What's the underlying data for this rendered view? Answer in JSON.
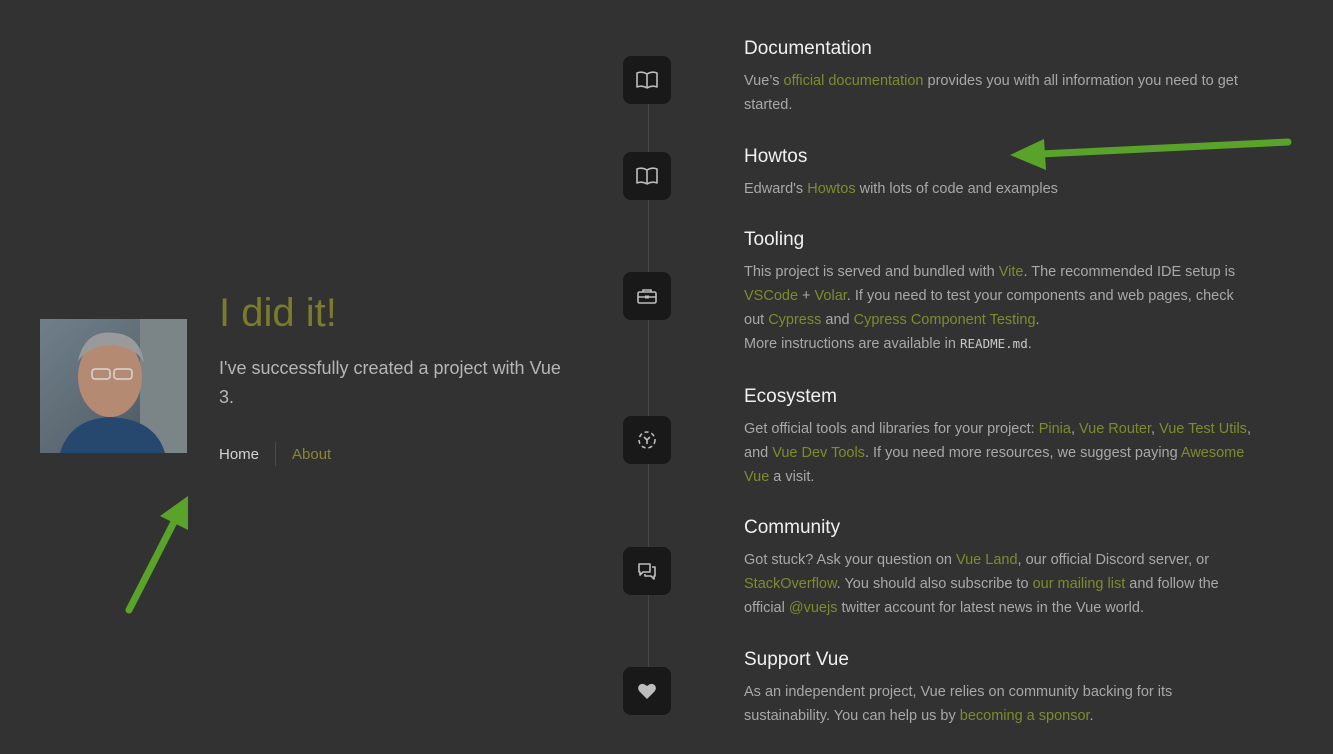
{
  "hero": {
    "title": "I did it!",
    "subtitle": "I've successfully created a project with Vue 3.",
    "nav": {
      "home": "Home",
      "about": "About"
    }
  },
  "items": {
    "documentation": {
      "title": "Documentation",
      "t1": "Vue’s ",
      "l1": "official documentation",
      "t2": " provides you with all information you need to get started."
    },
    "howtos": {
      "title": "Howtos",
      "t1": "Edward's ",
      "l1": "Howtos",
      "t2": " with lots of code and examples"
    },
    "tooling": {
      "title": "Tooling",
      "t1": "This project is served and bundled with ",
      "l_vite": "Vite",
      "t2": ". The recommended IDE setup is ",
      "l_vscode": "VSCode",
      "t3": " + ",
      "l_volar": "Volar",
      "t4": ". If you need to test your components and web pages, check out ",
      "l_cypress": "Cypress",
      "t5": " and ",
      "l_cct": "Cypress Component Testing",
      "t6": ".",
      "t7": "More instructions are available in ",
      "code": "README.md",
      "t8": "."
    },
    "ecosystem": {
      "title": "Ecosystem",
      "t1": "Get official tools and libraries for your project: ",
      "l_pinia": "Pinia",
      "t2": ", ",
      "l_router": "Vue Router",
      "t3": ", ",
      "l_test": "Vue Test Utils",
      "t4": ", and ",
      "l_devtools": "Vue Dev Tools",
      "t5": ". If you need more resources, we suggest paying ",
      "l_awesome": "Awesome Vue",
      "t6": " a visit."
    },
    "community": {
      "title": "Community",
      "t1": "Got stuck? Ask your question on ",
      "l_land": "Vue Land",
      "t2": ", our official Discord server, or ",
      "l_so": "StackOverflow",
      "t3": ". You should also subscribe to ",
      "l_mail": "our mailing list",
      "t4": " and follow the official ",
      "l_twitter": "@vuejs",
      "t5": " twitter account for latest news in the Vue world."
    },
    "support": {
      "title": "Support Vue",
      "t1": "As an independent project, Vue relies on community backing for its sustainability. You can help us by ",
      "l_sponsor": "becoming a sponsor",
      "t2": "."
    }
  },
  "icons": {
    "documentation": "book-icon",
    "howtos": "book-icon",
    "tooling": "toolbox-icon",
    "ecosystem": "ecosystem-icon",
    "community": "chat-icon",
    "support": "heart-icon"
  },
  "colors": {
    "background": "#323232",
    "accent": "#7f8b2c",
    "arrow": "#5aa32a"
  }
}
